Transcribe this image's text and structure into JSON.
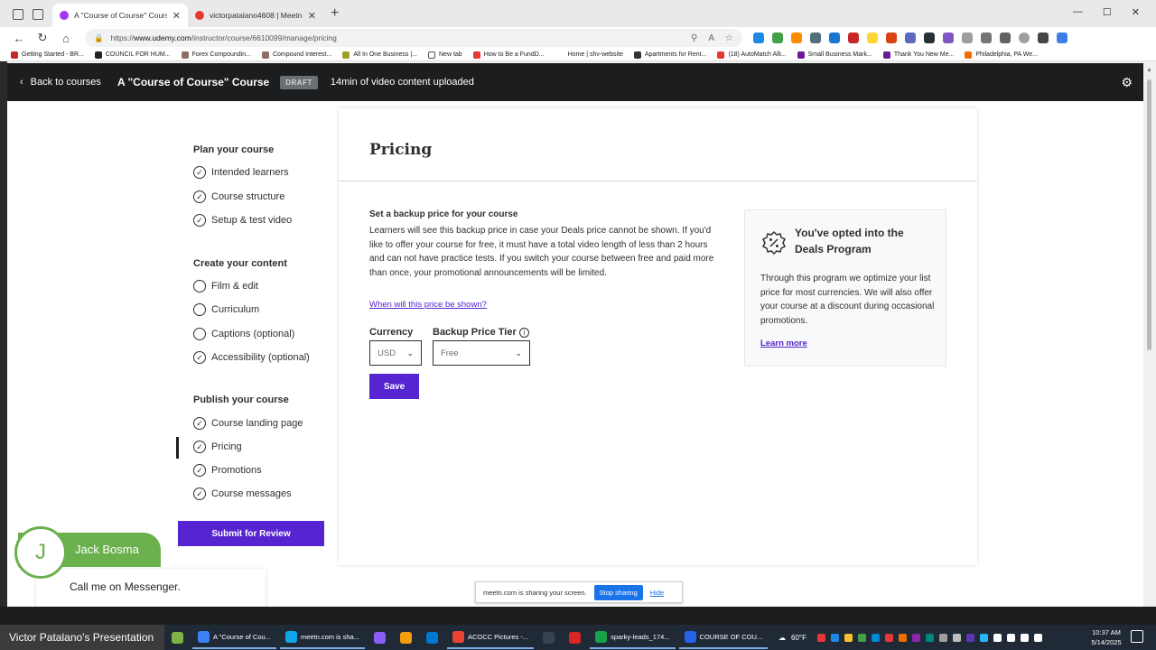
{
  "browser": {
    "tabs": [
      {
        "title": "A \"Course of Course\" Course | Ud",
        "active": true
      },
      {
        "title": "victorpatalano4608 | Meetn",
        "active": false
      }
    ],
    "url_prefix": "https://",
    "url_host": "www.udemy.com",
    "url_path": "/instructor/course/6610099/manage/pricing",
    "bookmarks": [
      "Getting Started - BR...",
      "COUNCIL FOR HUM...",
      "Forex Compoundin...",
      "Compound Interest...",
      "All In One Business |...",
      "New tab",
      "How to Be a FundD...",
      "Home | shv-website",
      "Apartments for Rent...",
      "(18) AutoMatch Alli...",
      "Small Business Mark...",
      "Thank You New Me...",
      "Philadelphia, PA We..."
    ]
  },
  "header": {
    "back_label": "Back to courses",
    "course_title": "A \"Course of Course\" Course",
    "draft_badge": "DRAFT",
    "uploaded_text": "14min of video content uploaded"
  },
  "sidebar": {
    "sections": [
      {
        "heading": "Plan your course",
        "items": [
          {
            "label": "Intended learners",
            "done": true
          },
          {
            "label": "Course structure",
            "done": true
          },
          {
            "label": "Setup & test video",
            "done": true
          }
        ]
      },
      {
        "heading": "Create your content",
        "items": [
          {
            "label": "Film & edit",
            "done": false
          },
          {
            "label": "Curriculum",
            "done": false
          },
          {
            "label": "Captions (optional)",
            "done": false
          },
          {
            "label": "Accessibility (optional)",
            "done": true
          }
        ]
      },
      {
        "heading": "Publish your course",
        "items": [
          {
            "label": "Course landing page",
            "done": true
          },
          {
            "label": "Pricing",
            "done": true,
            "active": true
          },
          {
            "label": "Promotions",
            "done": true
          },
          {
            "label": "Course messages",
            "done": true
          }
        ]
      }
    ],
    "submit_label": "Submit for Review"
  },
  "pricing": {
    "title": "Pricing",
    "backup_heading": "Set a backup price for your course",
    "backup_text": "Learners will see this backup price in case your Deals price cannot be shown. If you'd like to offer your course for free, it must have a total video length of less than 2 hours and can not have practice tests. If you switch your course between free and paid more than once, your promotional announcements will be limited.",
    "when_link": "When will this price be shown?",
    "currency_label": "Currency",
    "currency_value": "USD",
    "tier_label": "Backup Price Tier",
    "tier_value": "Free",
    "save_label": "Save"
  },
  "deals": {
    "title": "You've opted into the Deals Program",
    "body": "Through this program we optimize your list price for most currencies. We will also offer your course at a discount during occasional promotions.",
    "learn_more": "Learn more"
  },
  "share_banner": {
    "text": "meetn.com is sharing your screen.",
    "stop_label": "Stop sharing",
    "hide_label": "Hide"
  },
  "chat": {
    "initial": "J",
    "name": "Jack Bosma",
    "message": "Call me on Messenger."
  },
  "taskbar": {
    "presenter": "Victor Patalano's Presentation",
    "tasks": [
      {
        "label": "A \"Course of Cou...",
        "color": "#3b82f6"
      },
      {
        "label": "meetn.com is sha...",
        "color": "#0ea5e9"
      },
      {
        "label": "",
        "color": "#8b5cf6"
      },
      {
        "label": "",
        "color": "#f59e0b"
      },
      {
        "label": "",
        "color": "#0078d4"
      },
      {
        "label": "ACOCC Pictures -...",
        "color": "#ea4335"
      },
      {
        "label": "",
        "color": "#374151"
      },
      {
        "label": "",
        "color": "#dc2626"
      },
      {
        "label": "sparky-leads_174...",
        "color": "#16a34a"
      },
      {
        "label": "COURSE OF COU...",
        "color": "#2563eb"
      }
    ],
    "weather": "60°F",
    "time": "10:37 AM",
    "date": "5/14/2025"
  },
  "colors": {
    "udemy_purple": "#5624d0",
    "header_dark": "#1c1d1f",
    "chat_green": "#6ab04c"
  }
}
